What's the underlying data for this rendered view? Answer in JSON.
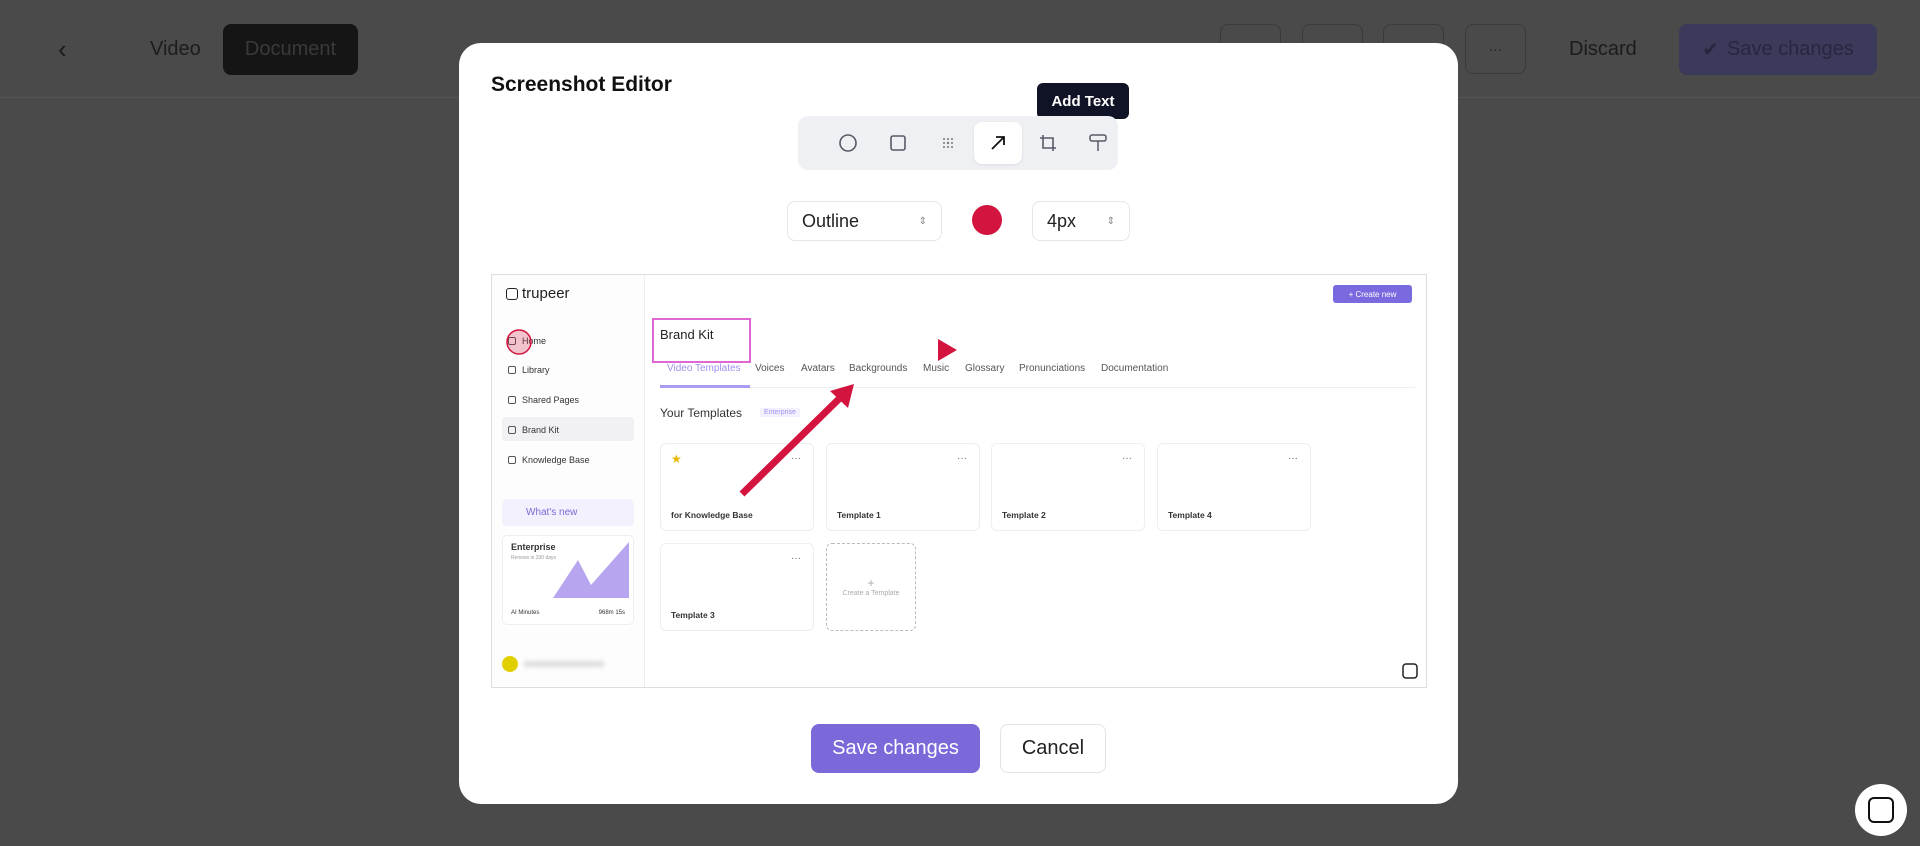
{
  "topbar": {
    "video_tab": "Video",
    "document_tab": "Document",
    "more_label": "···",
    "discard": "Discard",
    "save": "Save changes"
  },
  "modal": {
    "title": "Screenshot Editor",
    "tooltip": "Add Text",
    "style_select": "Outline",
    "color": "#d3143f",
    "size_select": "4px",
    "save": "Save changes",
    "cancel": "Cancel"
  },
  "screenshot": {
    "logo": "trupeer",
    "create_new": "+ Create new",
    "sidebar": [
      "Home",
      "Library",
      "Shared Pages",
      "Brand Kit",
      "Knowledge Base"
    ],
    "whats_new": "What's new",
    "plan": {
      "name": "Enterprise",
      "sub": "Renews in 330 days",
      "label": "AI Minutes",
      "value": "968m 15s"
    },
    "title": "Brand Kit",
    "tabs": [
      "Video Templates",
      "Voices",
      "Avatars",
      "Backgrounds",
      "Music",
      "Glossary",
      "Pronunciations",
      "Documentation"
    ],
    "section": "Your Templates",
    "badge": "Enterprise",
    "templates": [
      "for Knowledge Base",
      "Template 1",
      "Template 2",
      "Template 4",
      "Template 3"
    ],
    "create_template": "Create a Template"
  }
}
